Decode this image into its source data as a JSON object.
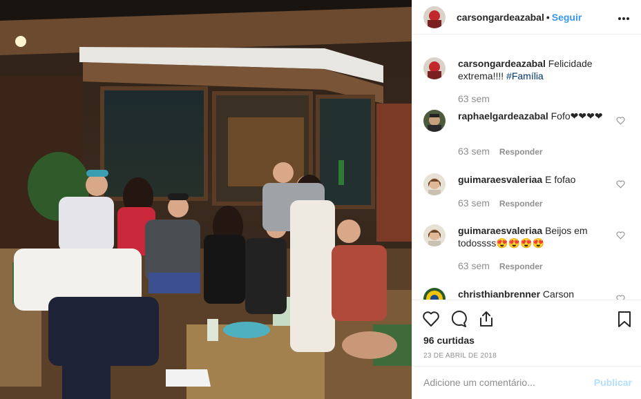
{
  "post": {
    "photo_alt": "",
    "author": "carsongardeazabal",
    "dot": "•",
    "follow_label": "Seguir",
    "more_icon": "more-icon"
  },
  "caption": {
    "user": "carsongardeazabal",
    "text": "Felicidade extrema!!!!",
    "hashtag": "#Família",
    "time": "63 sem"
  },
  "comments": [
    {
      "user": "raphaelgardeazabal",
      "text": "Fofo❤❤❤❤",
      "time": "63 sem",
      "reply": "Responder"
    },
    {
      "user": "guimaraesvaleriaa",
      "text": "E fofao",
      "time": "63 sem",
      "reply": "Responder"
    },
    {
      "user": "guimaraesvaleriaa",
      "text": "Beijos em todossss😍😍😍😍",
      "time": "63 sem",
      "reply": "Responder"
    },
    {
      "user": "christhianbrenner",
      "text": "Carson",
      "time": "",
      "reply": ""
    }
  ],
  "actions": {
    "like_icon": "heart-icon",
    "comment_icon": "comment-icon",
    "share_icon": "share-icon",
    "save_icon": "bookmark-icon",
    "likes": "96 curtidas",
    "date": "23 DE ABRIL DE 2018"
  },
  "composer": {
    "placeholder": "Adicione um comentário...",
    "publish_label": "Publicar"
  },
  "colors": {
    "link": "#3897f0",
    "hashtag": "#003569",
    "muted": "#8e8e8e",
    "publish_disabled": "#b2dffc"
  }
}
